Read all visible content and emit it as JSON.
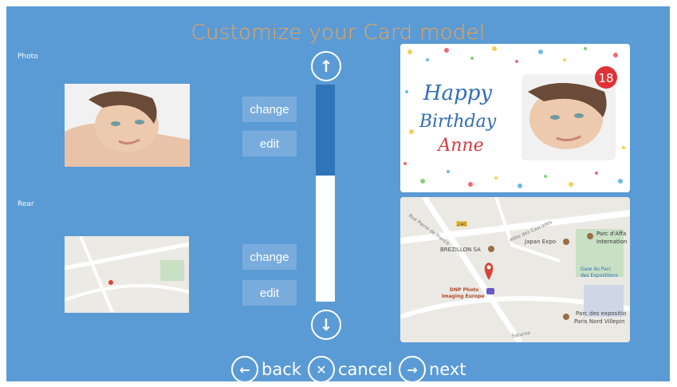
{
  "title": "Customize your Card model",
  "photo_section": {
    "label": "Photo",
    "change_label": "change",
    "edit_label": "edit"
  },
  "rear_section": {
    "label": "Rear",
    "change_label": "change",
    "edit_label": "edit"
  },
  "scroll": {
    "up_icon": "arrow-up-circle",
    "down_icon": "arrow-down-circle",
    "position_fraction": 0.0,
    "visible_fraction": 0.42
  },
  "front_preview": {
    "greeting_line1": "Happy",
    "greeting_line2": "Birthday",
    "name": "Anne",
    "badge_number": "18"
  },
  "map": {
    "place_brezillon": "BREZILLON SA",
    "place_japan_expo": "Japan Expo",
    "place_parc_line1": "Parc d'Affa",
    "place_parc_line2": "Internation",
    "place_gare_line1": "Gare du Parc",
    "place_gare_line2": "des Expositions",
    "place_dnp_line1": "DNP Photo",
    "place_dnp_line2": "Imaging Europe",
    "place_expo_line1": "Parc des expositio",
    "place_expo_line2": "Paris Nord Villepin",
    "street_pierre": "Rue Pierre de France",
    "street_cascades": "Allée des Cascades",
    "street_saturne": "Saturne",
    "road_label": "240"
  },
  "footer": {
    "back_label": "back",
    "cancel_label": "cancel",
    "next_label": "next"
  }
}
